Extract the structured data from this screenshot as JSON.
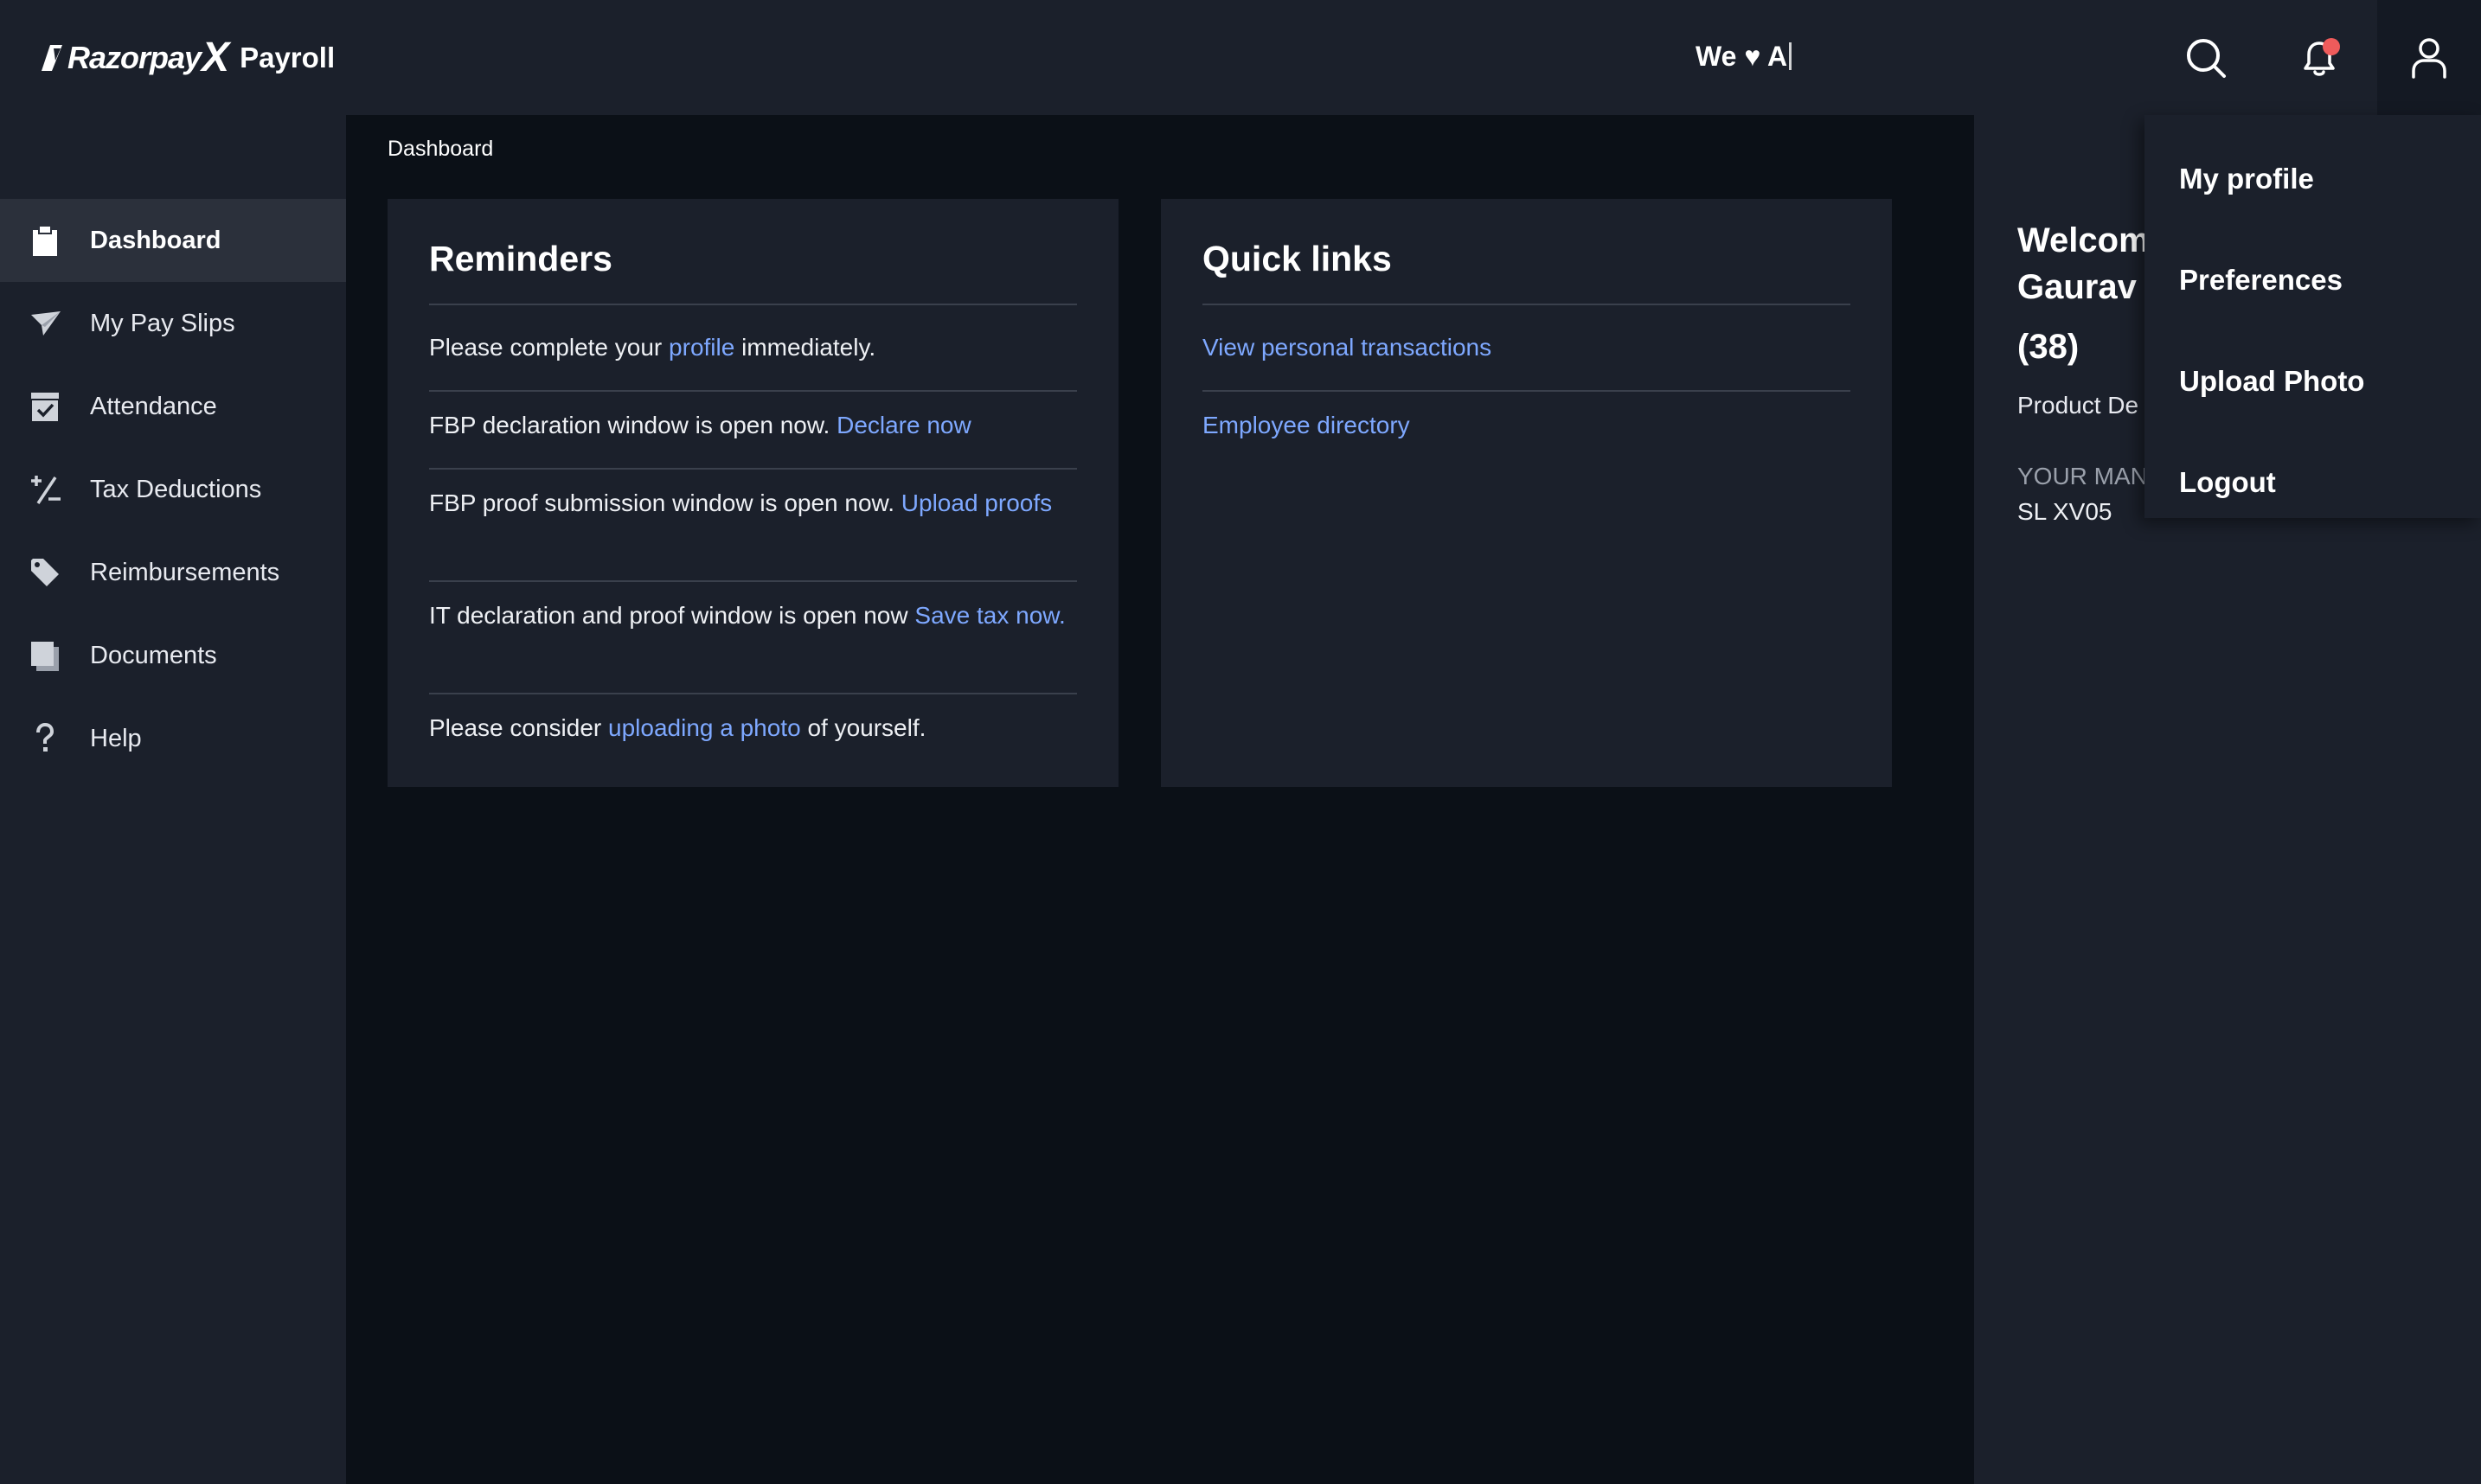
{
  "header": {
    "brand_name": "Razorpay",
    "brand_x": "X",
    "product": "Payroll",
    "tagline": "We ♥ A",
    "colors": {
      "topbar": "#1b202b",
      "notification_dot": "#ef5b5b"
    },
    "icons": [
      "search-icon",
      "bell-icon",
      "user-icon"
    ]
  },
  "sidebar": {
    "items": [
      {
        "label": "Dashboard",
        "icon": "clipboard-icon",
        "active": true
      },
      {
        "label": "My Pay Slips",
        "icon": "paper-plane-icon",
        "active": false
      },
      {
        "label": "Attendance",
        "icon": "calendar-check-icon",
        "active": false
      },
      {
        "label": "Tax Deductions",
        "icon": "percent-icon",
        "active": false
      },
      {
        "label": "Reimbursements",
        "icon": "tag-icon",
        "active": false
      },
      {
        "label": "Documents",
        "icon": "documents-icon",
        "active": false
      },
      {
        "label": "Help",
        "icon": "question-mark-icon",
        "active": false
      }
    ]
  },
  "main": {
    "breadcrumb": "Dashboard",
    "reminders": {
      "title": "Reminders",
      "items": [
        {
          "before": "Please complete your ",
          "link": "profile",
          "after": " immediately."
        },
        {
          "before": "FBP declaration window is open now. ",
          "link": "Declare now",
          "after": ""
        },
        {
          "before": "FBP proof submission window is open now. ",
          "link": "Upload proofs",
          "after": ""
        },
        {
          "before": "IT declaration and proof window is open now ",
          "link": "Save tax now.",
          "after": ""
        },
        {
          "before": "Please consider ",
          "link": "uploading a photo",
          "after": " of yourself."
        }
      ]
    },
    "quick_links": {
      "title": "Quick links",
      "items": [
        "View personal transactions",
        "Employee directory"
      ]
    },
    "link_color": "#7ea8ff"
  },
  "profile_panel": {
    "welcome": "Welcom",
    "name": "Gaurav",
    "employee_id": "(38)",
    "role": "Product De",
    "manager_label": "YOUR MAN",
    "manager_value": "SL XV05"
  },
  "user_menu": {
    "items": [
      "My profile",
      "Preferences",
      "Upload Photo",
      "Logout"
    ]
  }
}
